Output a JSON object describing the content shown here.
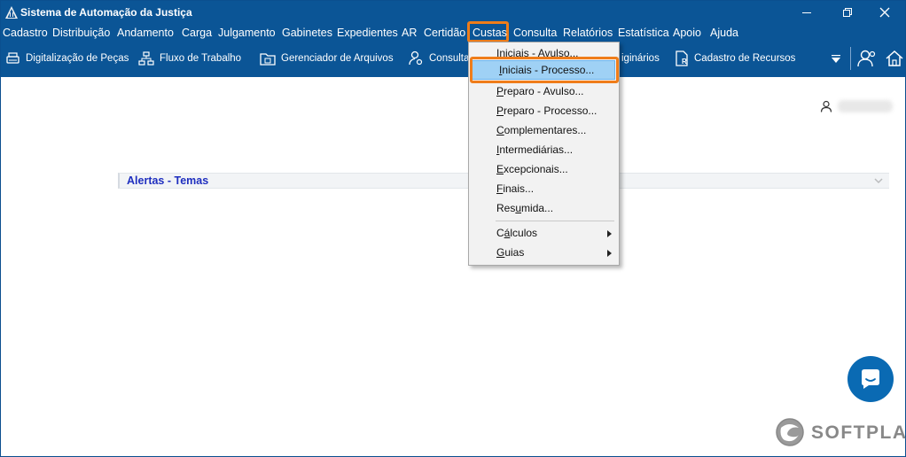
{
  "window": {
    "title": "Sistema de Automação da Justiça"
  },
  "menubar": {
    "items": [
      "Cadastro",
      "Distribuição",
      "Andamento",
      "Carga",
      "Julgamento",
      "Gabinetes",
      "Expedientes",
      "AR",
      "Certidão",
      "Custas",
      "Consulta",
      "Relatórios",
      "Estatística",
      "Apoio",
      "Ajuda"
    ],
    "active": "Custas"
  },
  "toolbar": {
    "items": [
      "Digitalização de Peças",
      "Fluxo de Trabalho",
      "Gerenciador de Arquivos",
      "Consulta",
      "iginários",
      "Cadastro de Recursos"
    ]
  },
  "dropdown": {
    "items": [
      {
        "label": "Iniciais - Avulso...",
        "mnemonic": "I",
        "rest": "niciais - Avulso...",
        "submenu": false
      },
      {
        "label": "Iniciais - Processo...",
        "mnemonic": "I",
        "rest": "niciais - Processo...",
        "submenu": false,
        "highlighted": true
      },
      {
        "label": "Preparo - Avulso...",
        "mnemonic": "P",
        "rest": "reparo - Avulso...",
        "submenu": false
      },
      {
        "label": "Preparo - Processo...",
        "mnemonic": "P",
        "rest": "reparo - Processo...",
        "submenu": false
      },
      {
        "label": "Complementares...",
        "mnemonic": "C",
        "rest": "omplementares...",
        "submenu": false
      },
      {
        "label": "Intermediárias...",
        "mnemonic": "I",
        "rest": "ntermediárias...",
        "submenu": false
      },
      {
        "label": "Excepcionais...",
        "mnemonic": "E",
        "rest": "xcepcionais...",
        "submenu": false
      },
      {
        "label": "Finais...",
        "mnemonic": "F",
        "rest": "inais...",
        "submenu": false
      },
      {
        "label": "Resumida...",
        "pre": "Res",
        "mnemonic": "u",
        "rest": "mida...",
        "submenu": false
      },
      {
        "label": "Cálculos",
        "pre": "C",
        "mnemonic": "á",
        "rest": "lculos",
        "submenu": true
      },
      {
        "label": "Guias",
        "mnemonic": "G",
        "rest": "uias",
        "submenu": true
      }
    ]
  },
  "content": {
    "alerts_title": "Alertas - Temas"
  },
  "branding": {
    "logo_text": "SOFTPLAN"
  },
  "colors": {
    "brand_blue": "#0b5596",
    "highlight_orange": "#ef7d1a",
    "menu_highlight": "#9fd1f5",
    "alert_title": "#1f2fbf"
  }
}
